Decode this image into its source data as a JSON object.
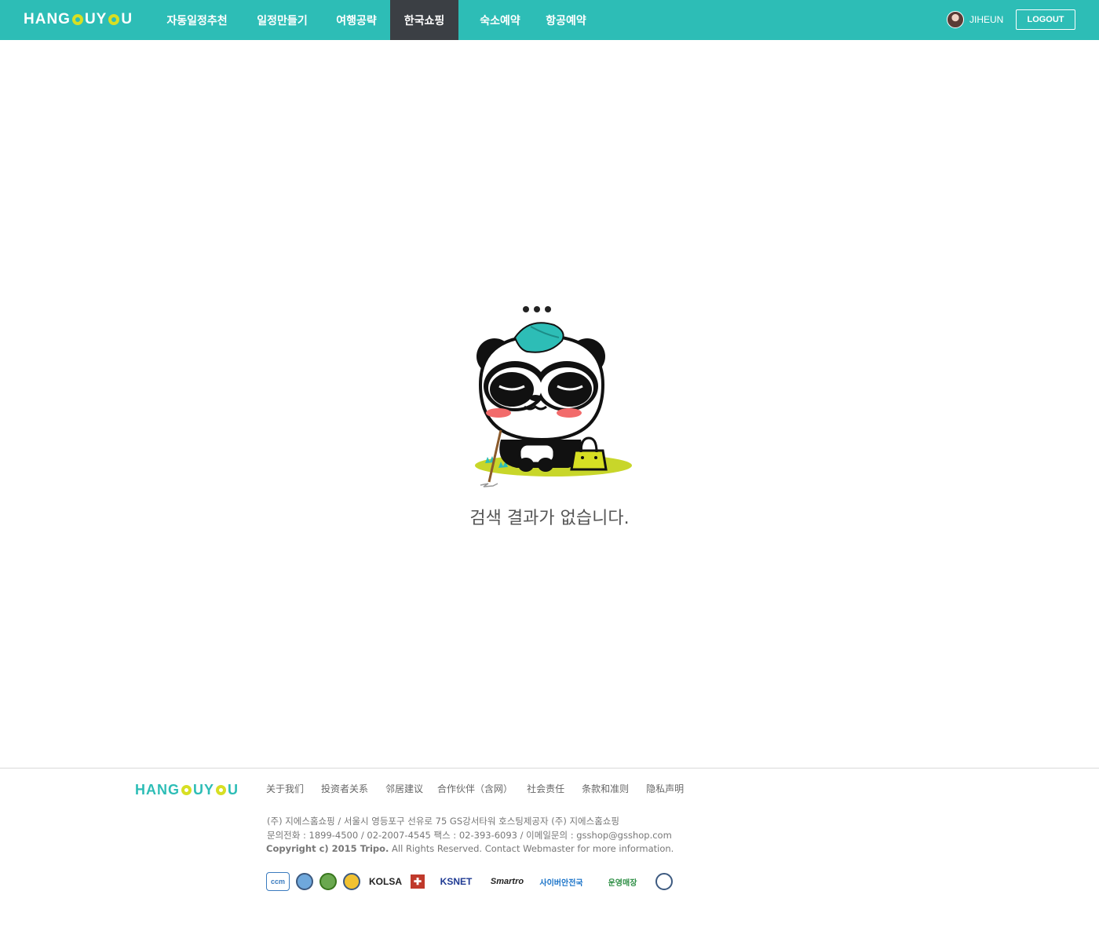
{
  "header": {
    "logo_left": "HANG",
    "logo_middle": "UY",
    "logo_right": "U",
    "nav": [
      {
        "label": "자동일정추천",
        "active": false
      },
      {
        "label": "일정만들기",
        "active": false
      },
      {
        "label": "여행공략",
        "active": false
      },
      {
        "label": "한국쇼핑",
        "active": true
      },
      {
        "label": "숙소예약",
        "active": false
      },
      {
        "label": "항공예약",
        "active": false
      }
    ],
    "username": "JIHEUN",
    "logout_label": "LOGOUT"
  },
  "empty_state": {
    "message": "검색 결과가 없습니다."
  },
  "footer": {
    "logo_left": "HANG",
    "logo_middle": "UY",
    "logo_right": "U",
    "links": [
      "关于我们",
      "投资者关系",
      "邻居建议",
      "合作伙伴（含网）",
      "社会责任",
      "条款和准则",
      "隐私声明"
    ],
    "company_line1": "(주) 지에스홈쇼핑  / 서울시 영등포구 선유로 75 GS강서타워 호스팅제공자 (주) 지에스홈쇼핑",
    "company_line2": "문의전화 : 1899-4500 / 02-2007-4545 팩스 : 02-393-6093 / 이메일문의 : gsshop@gsshop.com",
    "copyright_bold": "Copyright c) 2015 Tripo.",
    "copyright_rest": " All Rights Reserved. Contact Webmaster for more information.",
    "certs": [
      "ccm",
      "KOLSA",
      "KSNET",
      "Smartro",
      "사이버안전국",
      "운영매장"
    ]
  },
  "colors": {
    "brand": "#2dbdb6",
    "accent": "#d7df23",
    "nav_active": "#3b3f44"
  }
}
